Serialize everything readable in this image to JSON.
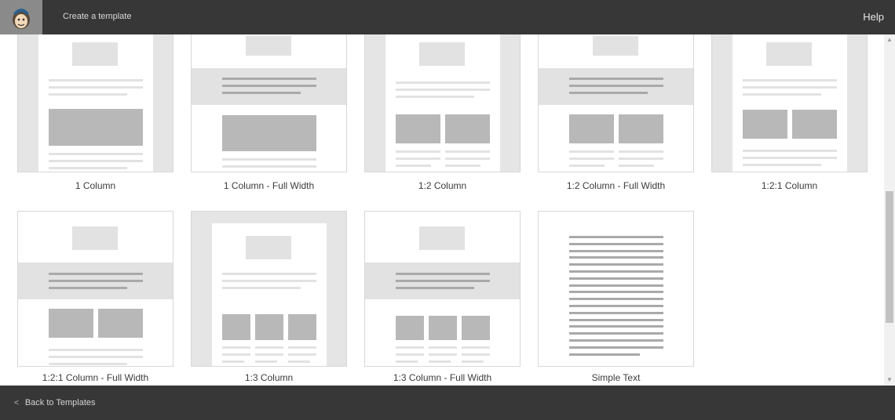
{
  "header": {
    "title": "Create a template",
    "help_label": "Help",
    "logo_icon": "mailchimp-freddie-icon"
  },
  "templates": [
    {
      "label": "1 Column",
      "layout": "one-column"
    },
    {
      "label": "1 Column - Full Width",
      "layout": "one-column-full-width"
    },
    {
      "label": "1:2 Column",
      "layout": "one-two-column"
    },
    {
      "label": "1:2 Column - Full Width",
      "layout": "one-two-column-full-width"
    },
    {
      "label": "1:2:1 Column",
      "layout": "one-two-one-column"
    },
    {
      "label": "1:2:1 Column - Full Width",
      "layout": "one-two-one-column-full-width"
    },
    {
      "label": "1:3 Column",
      "layout": "one-three-column"
    },
    {
      "label": "1:3 Column - Full Width",
      "layout": "one-three-column-full-width"
    },
    {
      "label": "Simple Text",
      "layout": "simple-text"
    }
  ],
  "footer": {
    "back_label": "Back to Templates",
    "back_icon": "chevron-left-icon"
  },
  "colors": {
    "bar_background": "#373737",
    "tile_border": "#d8d8d8",
    "placeholder_block": "#b8b8b8"
  }
}
